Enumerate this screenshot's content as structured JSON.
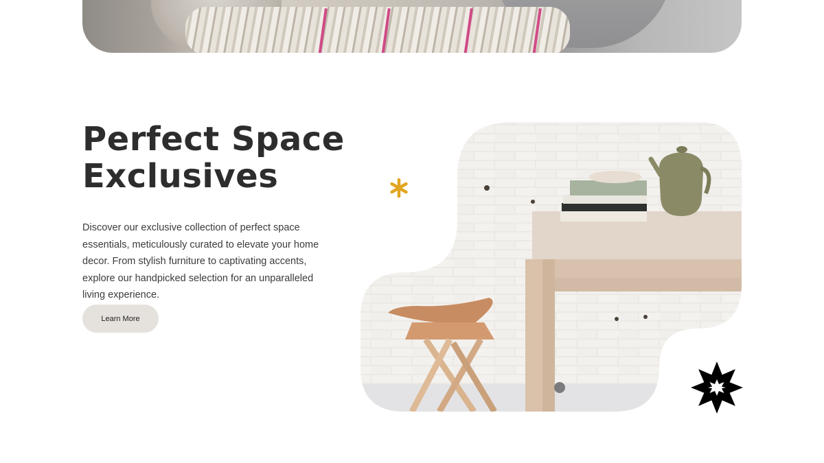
{
  "hero": {
    "title_line1": "Perfect Space",
    "title_line2": "Exclusives",
    "description": "Discover our exclusive collection of perfect space essentials, meticulously curated to elevate your home decor. From stylish furniture to captivating accents, explore our handpicked selection for an unparalleled living experience.",
    "cta_label": "Learn More"
  },
  "colors": {
    "accent_yellow": "#e0a521",
    "button_bg": "#e5e2dd",
    "star_black": "#000000"
  },
  "icons": {
    "asterisk": "asterisk-icon",
    "starburst": "starburst-icon"
  }
}
